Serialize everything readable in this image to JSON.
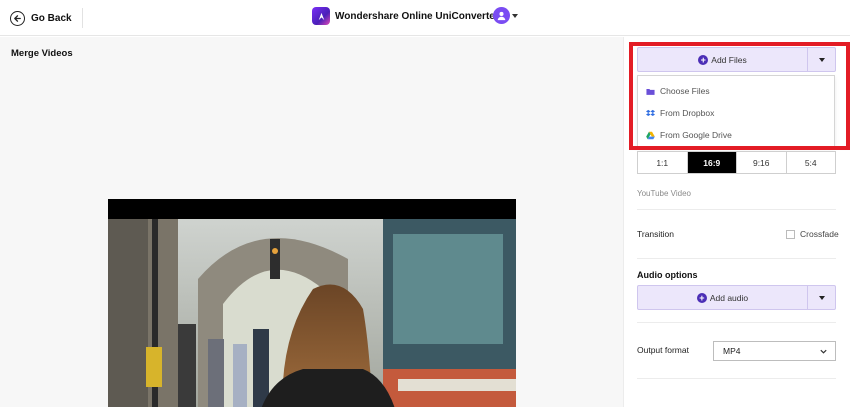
{
  "header": {
    "back_label": "Go Back",
    "brand_name": "Wondershare Online UniConverter",
    "back_icon": "arrow-left-circle-icon",
    "brand_icon": "uniconverter-logo-icon",
    "avatar_icon": "user-avatar-icon"
  },
  "workspace": {
    "title": "Merge Videos"
  },
  "panel": {
    "add_files_label": "Add Files",
    "menu": [
      {
        "label": "Choose Files",
        "icon": "folder-icon"
      },
      {
        "label": "From Dropbox",
        "icon": "dropbox-icon"
      },
      {
        "label": "From Google Drive",
        "icon": "google-drive-icon"
      }
    ],
    "ratios": [
      "1:1",
      "16:9",
      "9:16",
      "5:4"
    ],
    "active_ratio": "16:9",
    "ratio_note": "YouTube Video",
    "transition_label": "Transition",
    "crossfade_label": "Crossfade",
    "audio_heading": "Audio options",
    "add_audio_label": "Add audio",
    "output_format_label": "Output format",
    "output_format_value": "MP4"
  },
  "colors": {
    "accent_purple": "#4b2eb6",
    "button_bg": "#ece7fb",
    "highlight_red": "#e31c25"
  }
}
